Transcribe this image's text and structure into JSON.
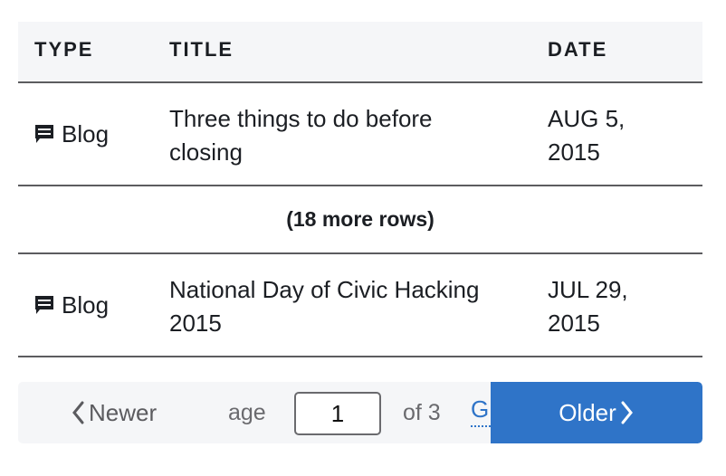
{
  "table": {
    "columns": [
      "TYPE",
      "TITLE",
      "DATE"
    ],
    "rows": [
      {
        "type": "Blog",
        "type_icon": "comment-icon",
        "title": "Three things to do before closing",
        "date": "AUG 5, 2015"
      },
      {
        "type": "Blog",
        "type_icon": "comment-icon",
        "title": "National Day of Civic Hacking 2015",
        "date": "JUL 29, 2015"
      }
    ],
    "collapsed_label": "(18 more rows)"
  },
  "pagination": {
    "newer_label": "Newer",
    "page_label": "age",
    "current_page": "1",
    "of_total": "of 3",
    "go_label": "G",
    "older_label": "Older"
  },
  "colors": {
    "accent": "#2f74c8",
    "header_bg": "#f5f6f8",
    "border": "#5c5c5f"
  }
}
